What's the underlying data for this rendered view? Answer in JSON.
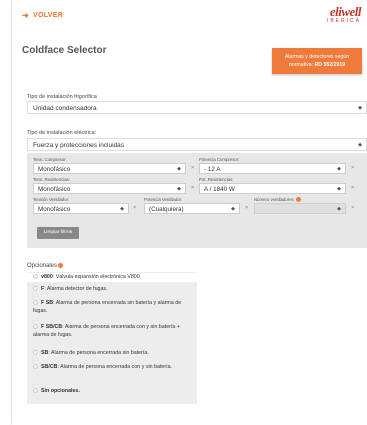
{
  "header": {
    "back_label": "VOLVER",
    "back_icon": "arrow-left-icon",
    "logo_text": "eliwell",
    "logo_sub": "IBERICA",
    "title": "Coldface Selector",
    "alert_line1": "Alarmas y detectores según",
    "alert_line2_prefix": "normativa: ",
    "alert_line2_bold": "RD 552/2019"
  },
  "fields": {
    "tipo_frigorifica_label": "Tipo de instalación frigorífica",
    "tipo_frigorifica_value": "Unidad condensadora",
    "tipo_electrica_label": "Tipo de instalación eléctrica:",
    "tipo_electrica_value": "Fuerza y protecciones incluidas"
  },
  "filters": {
    "tension_compresor_label": "Tens. Compresor:",
    "tension_compresor_value": "Monofásico",
    "potencia_compresor_label": "Potencia Compresor:",
    "potencia_compresor_value": "- 12 A",
    "tension_resistencias_label": "Tens. Resistencias:",
    "tension_resistencias_value": "Monofásico",
    "potencia_resistencias_label": "Pot. Resistencias:",
    "potencia_resistencias_value": "A / 1840 W",
    "tension_ventilador_label": "Tensión Ventilador:",
    "tension_ventilador_value": "Monofásico",
    "potencia_ventilador_label": "Potencia Ventilador:",
    "potencia_ventilador_value": "(Cualquiera)",
    "numero_ventiladores_label": "Número ventiladores",
    "numero_ventiladores_value": "",
    "clear_symbol": "×",
    "clear_button": "Limpiar filtros"
  },
  "opcionales": {
    "title": "Opcionales",
    "items": [
      {
        "bold": "v800",
        "text": ": Válvula expansión electrónica V800."
      },
      {
        "bold": "F",
        "text": ": Alarma detector de fugas."
      },
      {
        "bold": "F SB",
        "text": ": Alarma de persona encerrada sin batería y alarma de fugas."
      },
      {
        "bold": "F SB/CB",
        "text": ": Alarma de persona encerrada con y sin batería + alarma de fugas."
      },
      {
        "bold": "SB",
        "text": ": Alarma de persona encerrada sin batería."
      },
      {
        "bold": "SB/CB",
        "text": ": Alarma de persona encerrada con y sin batería."
      },
      {
        "bold": "Sin opcionales.",
        "text": ""
      }
    ]
  },
  "colors": {
    "accent": "#ee7a3b",
    "brand": "#c0392b",
    "panel": "#e7e7e7"
  }
}
